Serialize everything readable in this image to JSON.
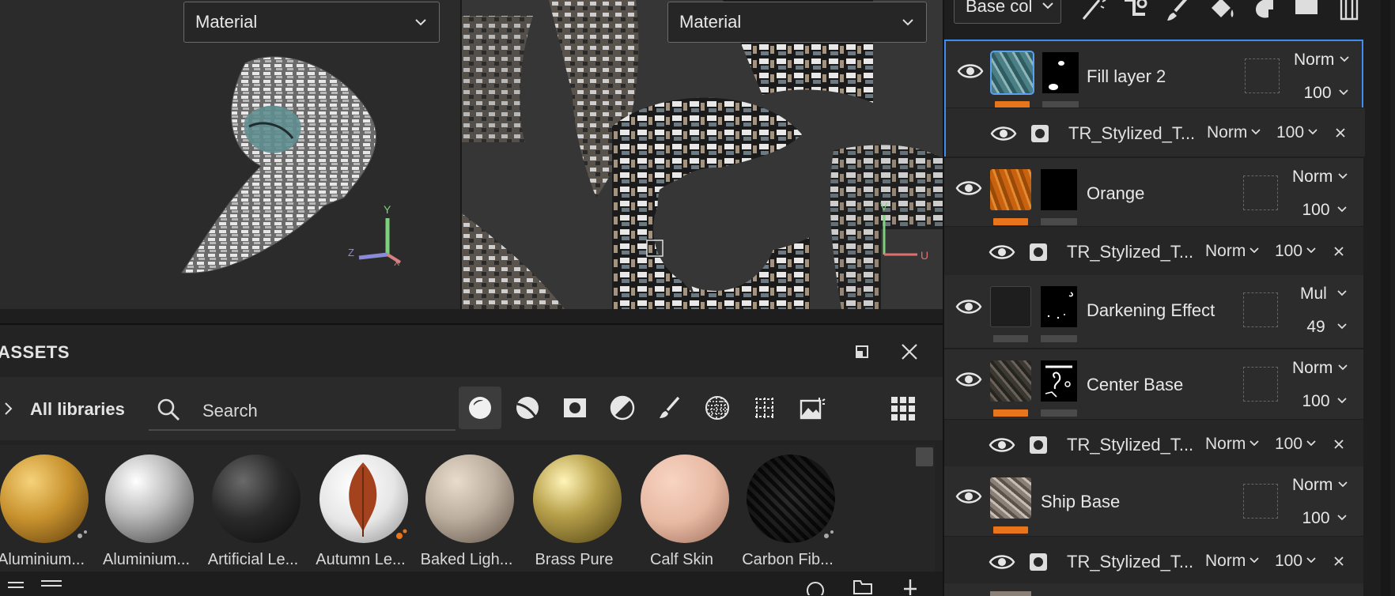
{
  "viewport_3d": {
    "dropdown_label": "Material",
    "axis_labels": [
      "Y",
      "Z",
      "X"
    ]
  },
  "viewport_2d": {
    "dropdown_label": "Material",
    "axis_labels": [
      "V",
      "U"
    ]
  },
  "assets": {
    "title": "ASSETS",
    "library_label": "All libraries",
    "search_placeholder": "Search",
    "filters": [
      "materials-filter-icon",
      "smart-materials-filter-icon",
      "smart-masks-filter-icon",
      "filters-filter-icon",
      "brushes-filter-icon",
      "alphas-filter-icon",
      "procedurals-filter-icon",
      "environments-filter-icon"
    ],
    "thumbnails": [
      {
        "name": "Aluminium...",
        "color": "#c8922e"
      },
      {
        "name": "Aluminium...",
        "color": "#bdbdbd"
      },
      {
        "name": "Artificial Le...",
        "color": "#2a2a2a"
      },
      {
        "name": "Autumn Le...",
        "color": "#e6e6e6"
      },
      {
        "name": "Baked Ligh...",
        "color": "#bcae9e"
      },
      {
        "name": "Brass Pure",
        "color": "#b9a24c"
      },
      {
        "name": "Calf Skin",
        "color": "#e7b9a3"
      },
      {
        "name": "Carbon Fib...",
        "color": "#2f2f2f"
      }
    ]
  },
  "layers_panel": {
    "channel_label": "Base col",
    "layers": [
      {
        "name": "Fill layer 2",
        "blend": "Norm",
        "opacity": "100",
        "color": "#e8741c",
        "thumb": "#4a7f86",
        "sub": {
          "name": "TR_Stylized_T...",
          "blend": "Norm",
          "opacity": "100"
        }
      },
      {
        "name": "Orange",
        "blend": "Norm",
        "opacity": "100",
        "color": "#e8741c",
        "thumb": "#c8620e",
        "sub": {
          "name": "TR_Stylized_T...",
          "blend": "Norm",
          "opacity": "100"
        }
      },
      {
        "name": "Darkening Effect",
        "blend": "Mul",
        "opacity": "49",
        "color": "#4a4a4a",
        "thumb": "#1e1e1e"
      },
      {
        "name": "Center Base",
        "blend": "Norm",
        "opacity": "100",
        "color": "#e8741c",
        "thumb": "#3b3834",
        "sub": {
          "name": "TR_Stylized_T...",
          "blend": "Norm",
          "opacity": "100"
        }
      },
      {
        "name": "Ship Base",
        "blend": "Norm",
        "opacity": "100",
        "color": "#e8741c",
        "thumb": "#8b8078",
        "sub": {
          "name": "TR_Stylized_T...",
          "blend": "Norm",
          "opacity": "100"
        }
      }
    ]
  },
  "colors": {
    "selection": "#3d8ef0",
    "accent": "#e8741c"
  }
}
